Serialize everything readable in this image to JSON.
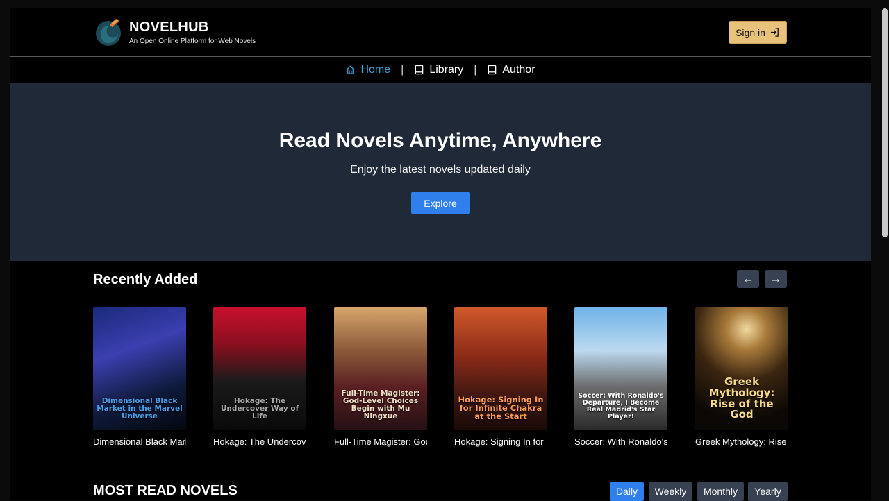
{
  "brand": {
    "title": "NOVELHUB",
    "tagline": "An Open Online Platform for Web Novels"
  },
  "header": {
    "signin_label": "Sign in"
  },
  "nav": {
    "items": [
      {
        "label": "Home",
        "icon": "home-icon",
        "active": true
      },
      {
        "label": "Library",
        "icon": "book-icon",
        "active": false
      },
      {
        "label": "Author",
        "icon": "book-icon",
        "active": false
      }
    ],
    "separator": "|"
  },
  "hero": {
    "title": "Read Novels Anytime, Anywhere",
    "subtitle": "Enjoy the latest novels updated daily",
    "button_label": "Explore"
  },
  "recent": {
    "title": "Recently Added",
    "prev_label": "←",
    "next_label": "→",
    "books": [
      {
        "title": "Dimensional Black Market in the Marvel Universe",
        "cover_text": "Dimensional Black Market in the Marvel Universe",
        "cover_color": "#4aa0e8"
      },
      {
        "title": "Hokage: The Undercover Way of Life",
        "cover_text": "Hokage: The Undercover Way of Life",
        "cover_color": "#a8a8a8"
      },
      {
        "title": "Full-Time Magister: God-Level Choices Begin with Mu Ningxue",
        "cover_text": "Full-Time Magister: God-Level Choices Begin with Mu Ningxue",
        "cover_color": "#f3e0c9"
      },
      {
        "title": "Hokage: Signing In for Infinite Chakra at the Start",
        "cover_text": "Hokage: Signing In for Infinite Chakra at the Start",
        "cover_color": "#ff9a55"
      },
      {
        "title": "Soccer: With Ronaldo's Departure, I Become Real Madrid's Star Player!",
        "cover_text": "Soccer: With Ronaldo's Departure, I Become Real Madrid's Star Player!",
        "cover_color": "#ffffff"
      },
      {
        "title": "Greek Mythology: Rise of the God",
        "cover_text": "Greek Mythology: Rise of the God",
        "cover_color": "#f5d98a"
      }
    ]
  },
  "most_read": {
    "title": "MOST READ NOVELS",
    "tabs": [
      {
        "label": "Daily",
        "active": true
      },
      {
        "label": "Weekly",
        "active": false
      },
      {
        "label": "Monthly",
        "active": false
      },
      {
        "label": "Yearly",
        "active": false
      }
    ]
  },
  "colors": {
    "accent": "#2f80ed",
    "signin_bg": "#e8c27a",
    "hero_bg": "#1f2937",
    "active_nav": "#3fa4d8"
  }
}
